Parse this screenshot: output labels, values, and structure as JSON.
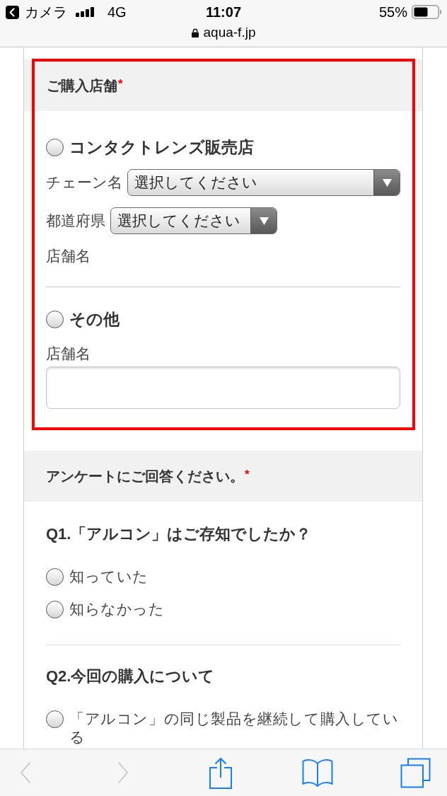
{
  "status_bar": {
    "back_app": "カメラ",
    "network": "4G",
    "time": "11:07",
    "battery": "55%"
  },
  "address_bar": {
    "url": "aqua-f.jp"
  },
  "sections": [
    {
      "kind": "store",
      "title": "ご購入店舗",
      "required_mark": "*",
      "highlighted": true,
      "options": [
        {
          "label": "コンタクトレンズ販売店",
          "selected": false,
          "fields": [
            {
              "kind": "select",
              "label": "チェーン名",
              "value": "選択してください",
              "full_width": true
            },
            {
              "kind": "select",
              "label": "都道府県",
              "value": "選択してください",
              "full_width": false
            },
            {
              "kind": "label",
              "label": "店舗名"
            }
          ]
        },
        {
          "label": "その他",
          "selected": false,
          "fields": [
            {
              "kind": "input",
              "label": "店舗名"
            }
          ]
        }
      ]
    },
    {
      "kind": "survey",
      "title": "アンケートにご回答ください。",
      "required_mark": "*",
      "highlighted": false,
      "questions": [
        {
          "title": "Q1.「アルコン」はご存知でしたか？",
          "options": [
            {
              "label": "知っていた",
              "selected": false
            },
            {
              "label": "知らなかった",
              "selected": false
            }
          ]
        },
        {
          "title": "Q2.今回の購入について",
          "options": [
            {
              "label": "「アルコン」の同じ製品を継続して購入している",
              "selected": false
            }
          ]
        }
      ]
    }
  ],
  "toolbar": [
    {
      "kind": "back",
      "disabled": true
    },
    {
      "kind": "forward",
      "disabled": true
    },
    {
      "kind": "share",
      "disabled": false
    },
    {
      "kind": "bookmarks",
      "disabled": false
    },
    {
      "kind": "tabs",
      "disabled": false
    }
  ]
}
